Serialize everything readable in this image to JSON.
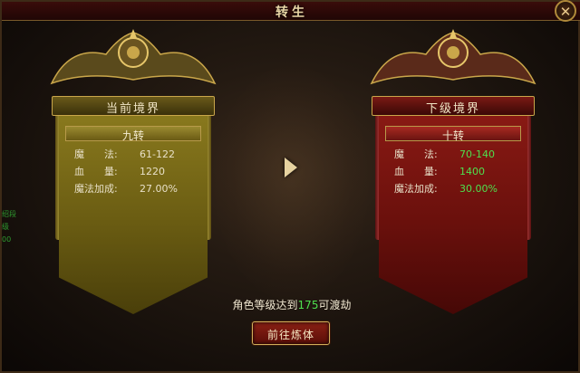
{
  "window": {
    "title": "转生",
    "close_glyph": "✕"
  },
  "side_text": [
    "绍段",
    "级",
    "00"
  ],
  "current": {
    "header": "当前境界",
    "tier": "九转",
    "stats": [
      {
        "label": "魔　　法:",
        "value": "61-122"
      },
      {
        "label": "血　　量:",
        "value": "1220"
      },
      {
        "label": "魔法加成:",
        "value": "27.00%"
      }
    ]
  },
  "next": {
    "header": "下级境界",
    "tier": "十转",
    "stats": [
      {
        "label": "魔　　法:",
        "value": "70-140"
      },
      {
        "label": "血　　量:",
        "value": "1400"
      },
      {
        "label": "魔法加成:",
        "value": "30.00%"
      }
    ]
  },
  "requirement": {
    "prefix": "角色等级达到",
    "level": "175",
    "suffix": "可渡劫"
  },
  "button": {
    "label": "前往炼体"
  },
  "colors": {
    "gold": "#c9a64a",
    "green": "#4ee04e",
    "red_banner": "#8a1a14",
    "yellow_banner": "#8a7a1e"
  }
}
